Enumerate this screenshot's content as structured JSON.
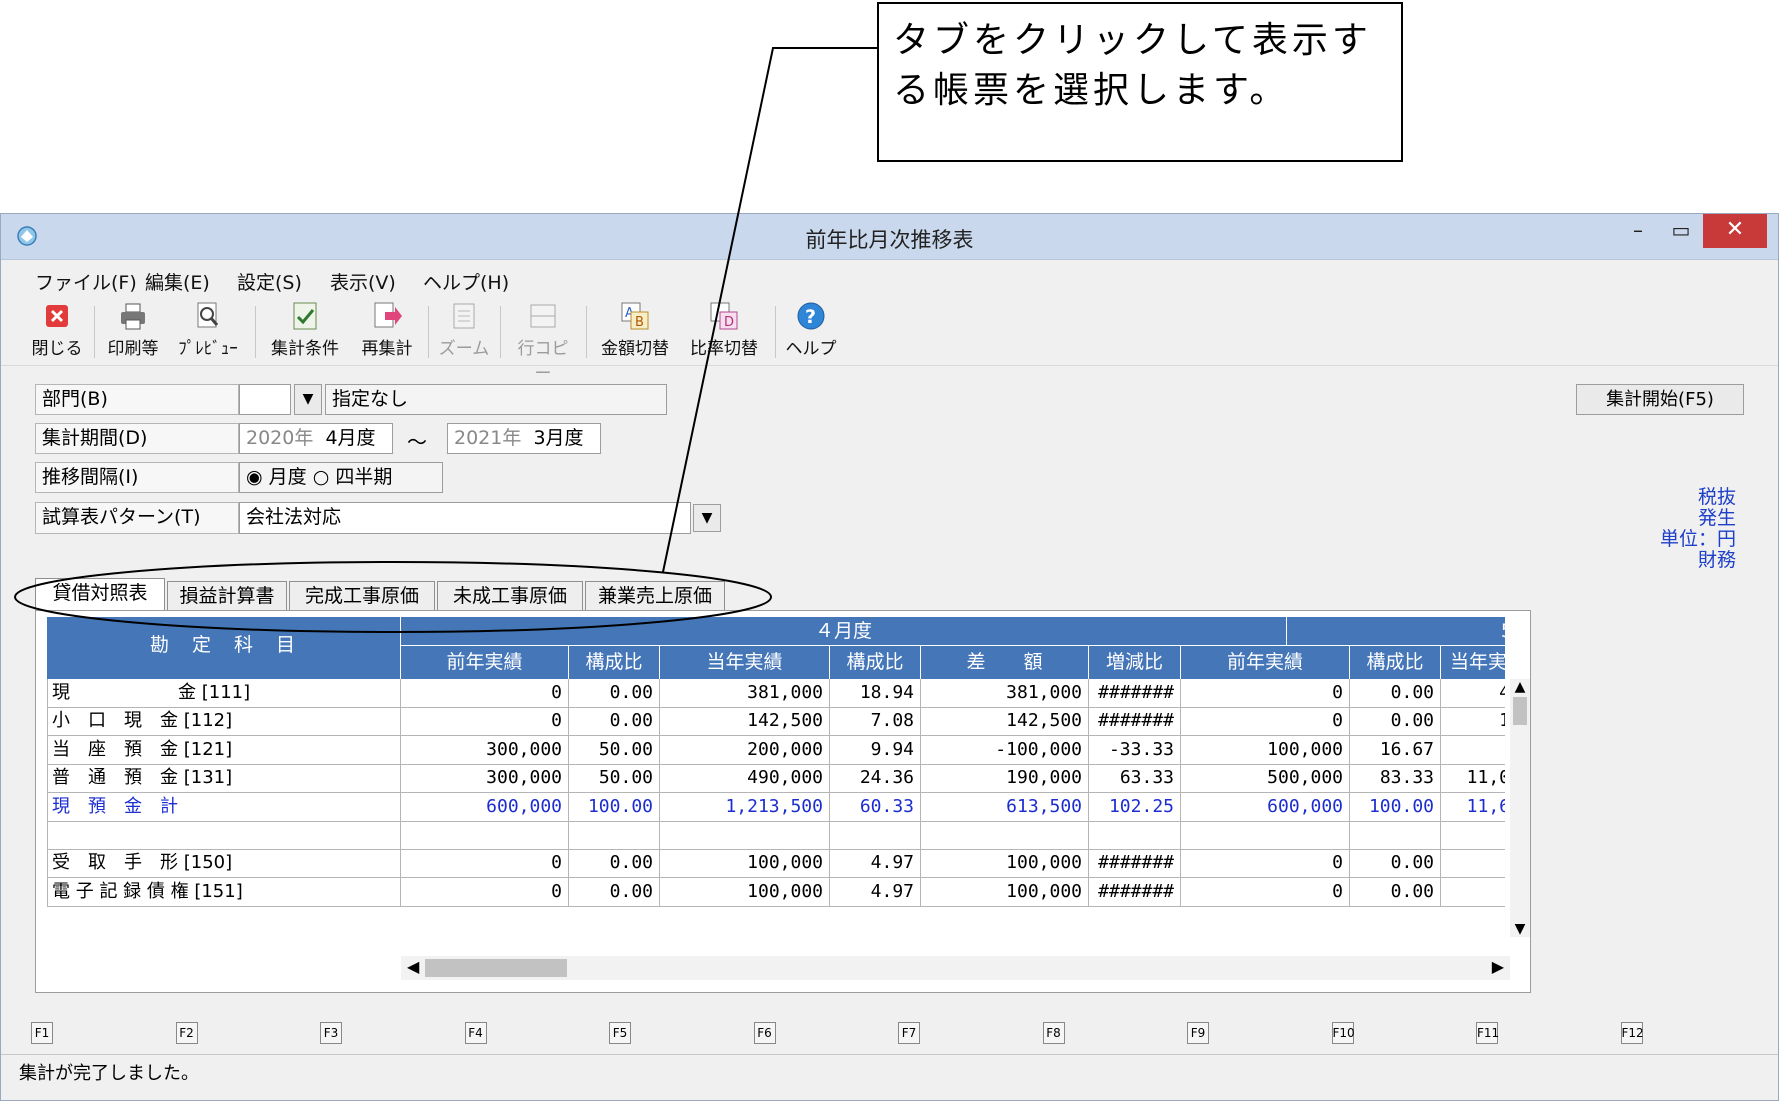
{
  "callout": {
    "line1": "タブをクリックして表示す",
    "line2": "る帳票を選択します。"
  },
  "window": {
    "title": "前年比月次推移表",
    "min": "–",
    "max": "▭",
    "close": "✕"
  },
  "menu": [
    "ファイル(F)",
    "編集(E)",
    "設定(S)",
    "表示(V)",
    "ヘルプ(H)"
  ],
  "toolbar": {
    "close": "閉じる",
    "print": "印刷等",
    "preview": "ﾌﾟﾚﾋﾞｭｰ",
    "conditions": "集計条件",
    "recalc": "再集計",
    "zoom": "ズーム",
    "rowcopy": "行コピー",
    "amount_switch": "金額切替",
    "ratio_switch": "比率切替",
    "help": "ヘルプ"
  },
  "form": {
    "dept_label": "部門(B)",
    "dept_value": "指定なし",
    "period_label": "集計期間(D)",
    "period_from_year": "2020年",
    "period_from_month": "4月度",
    "period_sep": "～",
    "period_to_year": "2021年",
    "period_to_month": "3月度",
    "interval_label": "推移間隔(I)",
    "interval_monthly": "月度",
    "interval_quarterly": "四半期",
    "pattern_label": "試算表パターン(T)",
    "pattern_value": "会社法対応",
    "start_button": "集計開始(F5)"
  },
  "notes": {
    "tax": "税抜",
    "basis": "発生",
    "unit": "単位：円",
    "mode": "財務"
  },
  "tabs": [
    "貸借対照表",
    "損益計算書",
    "完成工事原価",
    "未成工事原価",
    "兼業売上原価"
  ],
  "table": {
    "account_header": "勘　定　科　目",
    "month1": "４月度",
    "month2": "5",
    "cols": [
      "前年実績",
      "構成比",
      "当年実績",
      "構成比",
      "差　　額",
      "増減比",
      "前年実績",
      "構成比",
      "当年実績"
    ],
    "rows": [
      {
        "name": "現　　　　　　金 [111]",
        "v": [
          "0",
          "0.00",
          "381,000",
          "18.94",
          "381,000",
          "#######",
          "0",
          "0.00",
          "4"
        ],
        "blue": false
      },
      {
        "name": "小　口　現　金 [112]",
        "v": [
          "0",
          "0.00",
          "142,500",
          "7.08",
          "142,500",
          "#######",
          "0",
          "0.00",
          "1"
        ],
        "blue": false
      },
      {
        "name": "当　座　預　金 [121]",
        "v": [
          "300,000",
          "50.00",
          "200,000",
          "9.94",
          "-100,000",
          "-33.33",
          "100,000",
          "16.67",
          ""
        ],
        "blue": false
      },
      {
        "name": "普　通　預　金 [131]",
        "v": [
          "300,000",
          "50.00",
          "490,000",
          "24.36",
          "190,000",
          "63.33",
          "500,000",
          "83.33",
          "11,0"
        ],
        "blue": false
      },
      {
        "name": "現　預　金　計",
        "v": [
          "600,000",
          "100.00",
          "1,213,500",
          "60.33",
          "613,500",
          "102.25",
          "600,000",
          "100.00",
          "11,6"
        ],
        "blue": true
      },
      {
        "name": "",
        "v": [
          "",
          "",
          "",
          "",
          "",
          "",
          "",
          "",
          ""
        ],
        "blue": false
      },
      {
        "name": "受　取　手　形 [150]",
        "v": [
          "0",
          "0.00",
          "100,000",
          "4.97",
          "100,000",
          "#######",
          "0",
          "0.00",
          ""
        ],
        "blue": false
      },
      {
        "name": "電 子 記 録 債 権 [151]",
        "v": [
          "0",
          "0.00",
          "100,000",
          "4.97",
          "100,000",
          "#######",
          "0",
          "0.00",
          ""
        ],
        "blue": false
      }
    ]
  },
  "fkeys": [
    "F1",
    "F2",
    "F3",
    "F4",
    "F5",
    "F6",
    "F7",
    "F8",
    "F9",
    "F10",
    "F11",
    "F12"
  ],
  "status": "集計が完了しました。"
}
